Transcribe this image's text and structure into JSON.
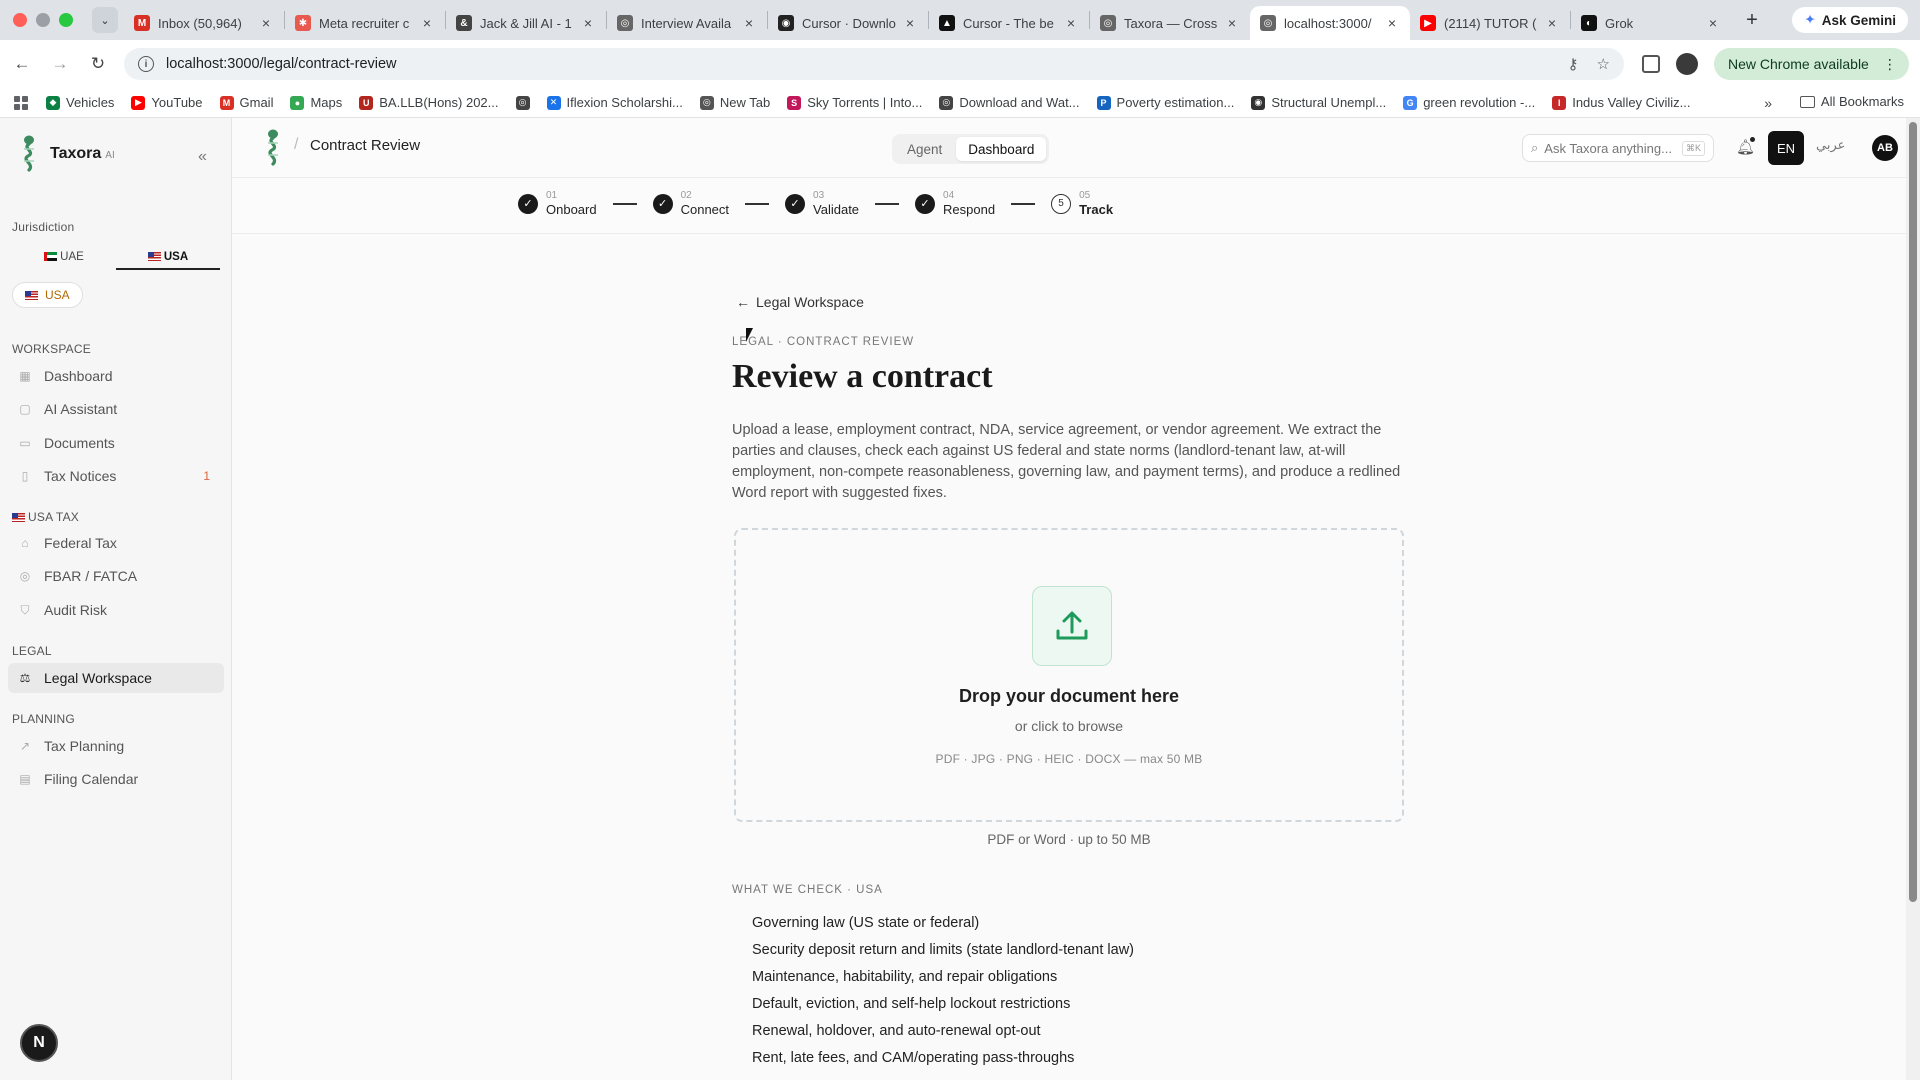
{
  "browser": {
    "tabs": [
      {
        "title": "Inbox (50,964)",
        "icon": "gmail-icon",
        "color": "#d93025",
        "glyph": "M"
      },
      {
        "title": "Meta recruiter c",
        "icon": "asterisk-icon",
        "color": "#e8594f",
        "glyph": "✱"
      },
      {
        "title": "Jack & Jill AI - 1",
        "icon": "ampersand-icon",
        "color": "#444444",
        "glyph": "&"
      },
      {
        "title": "Interview Availa",
        "icon": "globe-icon",
        "color": "#666666",
        "glyph": "◎"
      },
      {
        "title": "Cursor · Downlo",
        "icon": "github-icon",
        "color": "#222222",
        "glyph": "◉"
      },
      {
        "title": "Cursor - The be",
        "icon": "cursor-app-icon",
        "color": "#111111",
        "glyph": "▲"
      },
      {
        "title": "Taxora — Cross",
        "icon": "globe-icon",
        "color": "#666666",
        "glyph": "◎"
      },
      {
        "title": "localhost:3000/",
        "icon": "globe-icon",
        "color": "#666666",
        "glyph": "◎",
        "active": true
      },
      {
        "title": "(2114) TUTOR (",
        "icon": "youtube-icon",
        "color": "#ff0000",
        "glyph": "▶"
      },
      {
        "title": "Grok",
        "icon": "grok-icon",
        "color": "#111111",
        "glyph": "◐"
      }
    ],
    "gemini_label": "Ask Gemini",
    "url": "localhost:3000/legal/contract-review",
    "new_chrome_label": "New Chrome available",
    "bookmarks": [
      {
        "label": "Vehicles",
        "icon": "vehicles-icon",
        "color": "#0b8043",
        "glyph": "◆"
      },
      {
        "label": "YouTube",
        "icon": "youtube-icon",
        "color": "#ff0000",
        "glyph": "▶"
      },
      {
        "label": "Gmail",
        "icon": "gmail-icon",
        "color": "#d93025",
        "glyph": "M"
      },
      {
        "label": "Maps",
        "icon": "maps-icon",
        "color": "#34a853",
        "glyph": "●"
      },
      {
        "label": "BA.LLB(Hons) 202...",
        "icon": "university-icon",
        "color": "#b3261e",
        "glyph": "U"
      },
      {
        "label": "",
        "icon": "globe-icon",
        "color": "#444444",
        "glyph": "◎"
      },
      {
        "label": "Iflexion Scholarshi...",
        "icon": "iflexion-icon",
        "color": "#1a73e8",
        "glyph": "✕"
      },
      {
        "label": "New Tab",
        "icon": "chrome-icon",
        "color": "#555555",
        "glyph": "◎"
      },
      {
        "label": "Sky Torrents | Into...",
        "icon": "torrent-icon",
        "color": "#c2185b",
        "glyph": "S"
      },
      {
        "label": "Download and Wat...",
        "icon": "globe-icon",
        "color": "#444444",
        "glyph": "◎"
      },
      {
        "label": "Poverty estimation...",
        "icon": "pib-icon",
        "color": "#1565c0",
        "glyph": "P"
      },
      {
        "label": "Structural Unempl...",
        "icon": "structural-icon",
        "color": "#333333",
        "glyph": "◉"
      },
      {
        "label": "green revolution -...",
        "icon": "google-icon",
        "color": "#4285f4",
        "glyph": "G"
      },
      {
        "label": "Indus Valley Civiliz...",
        "icon": "indus-icon",
        "color": "#c62828",
        "glyph": "I"
      }
    ],
    "all_bookmarks": "All Bookmarks"
  },
  "sidebar": {
    "brand": "Taxora",
    "brand_suffix": "AI",
    "jurisdiction_label": "Jurisdiction",
    "jurisdictions": [
      "UAE",
      "USA"
    ],
    "active_jurisdiction": "USA",
    "chip": "USA",
    "sections": {
      "workspace": "WORKSPACE",
      "usa_tax": "USA TAX",
      "legal": "LEGAL",
      "planning": "PLANNING"
    },
    "items": {
      "dashboard": "Dashboard",
      "ai_assistant": "AI Assistant",
      "documents": "Documents",
      "tax_notices": "Tax Notices",
      "tax_notices_count": "1",
      "federal_tax": "Federal Tax",
      "fbar": "FBAR / FATCA",
      "audit_risk": "Audit Risk",
      "legal_workspace": "Legal Workspace",
      "tax_planning": "Tax Planning",
      "filing_calendar": "Filing Calendar"
    },
    "avatar": "N"
  },
  "header": {
    "crumb": "Contract Review",
    "modes": [
      "Agent",
      "Dashboard"
    ],
    "active_mode": "Dashboard",
    "search_placeholder": "Ask Taxora anything...",
    "search_kbd": "⌘K",
    "lang_en": "EN",
    "lang_ar": "عربي",
    "avatar": "AB"
  },
  "stepper": [
    {
      "num": "01",
      "label": "Onboard",
      "done": true
    },
    {
      "num": "02",
      "label": "Connect",
      "done": true
    },
    {
      "num": "03",
      "label": "Validate",
      "done": true
    },
    {
      "num": "04",
      "label": "Respond",
      "done": true
    },
    {
      "num": "05",
      "label": "Track",
      "done": false,
      "index": "5"
    }
  ],
  "main": {
    "back": "Legal Workspace",
    "eyebrow": "LEGAL · CONTRACT REVIEW",
    "title": "Review a contract",
    "description": "Upload a lease, employment contract, NDA, service agreement, or vendor agreement. We extract the parties and clauses, check each against US federal and state norms (landlord-tenant law, at-will employment, non-compete reasonableness, governing law, and payment terms), and produce a redlined Word report with suggested fixes.",
    "drop_title": "Drop your document here",
    "drop_sub": "or click to browse",
    "drop_types": "PDF · JPG · PNG · HEIC · DOCX — max 50 MB",
    "limit": "PDF or Word · up to 50 MB",
    "check_label": "WHAT WE CHECK · USA",
    "checks": [
      "Governing law (US state or federal)",
      "Security deposit return and limits (state landlord-tenant law)",
      "Maintenance, habitability, and repair obligations",
      "Default, eviction, and self-help lockout restrictions",
      "Renewal, holdover, and auto-renewal opt-out",
      "Rent, late fees, and CAM/operating pass-throughs"
    ]
  },
  "colors": {
    "accent_green": "#1e9a5b",
    "badge": "#e0633b",
    "chip_text": "#b06a00"
  }
}
